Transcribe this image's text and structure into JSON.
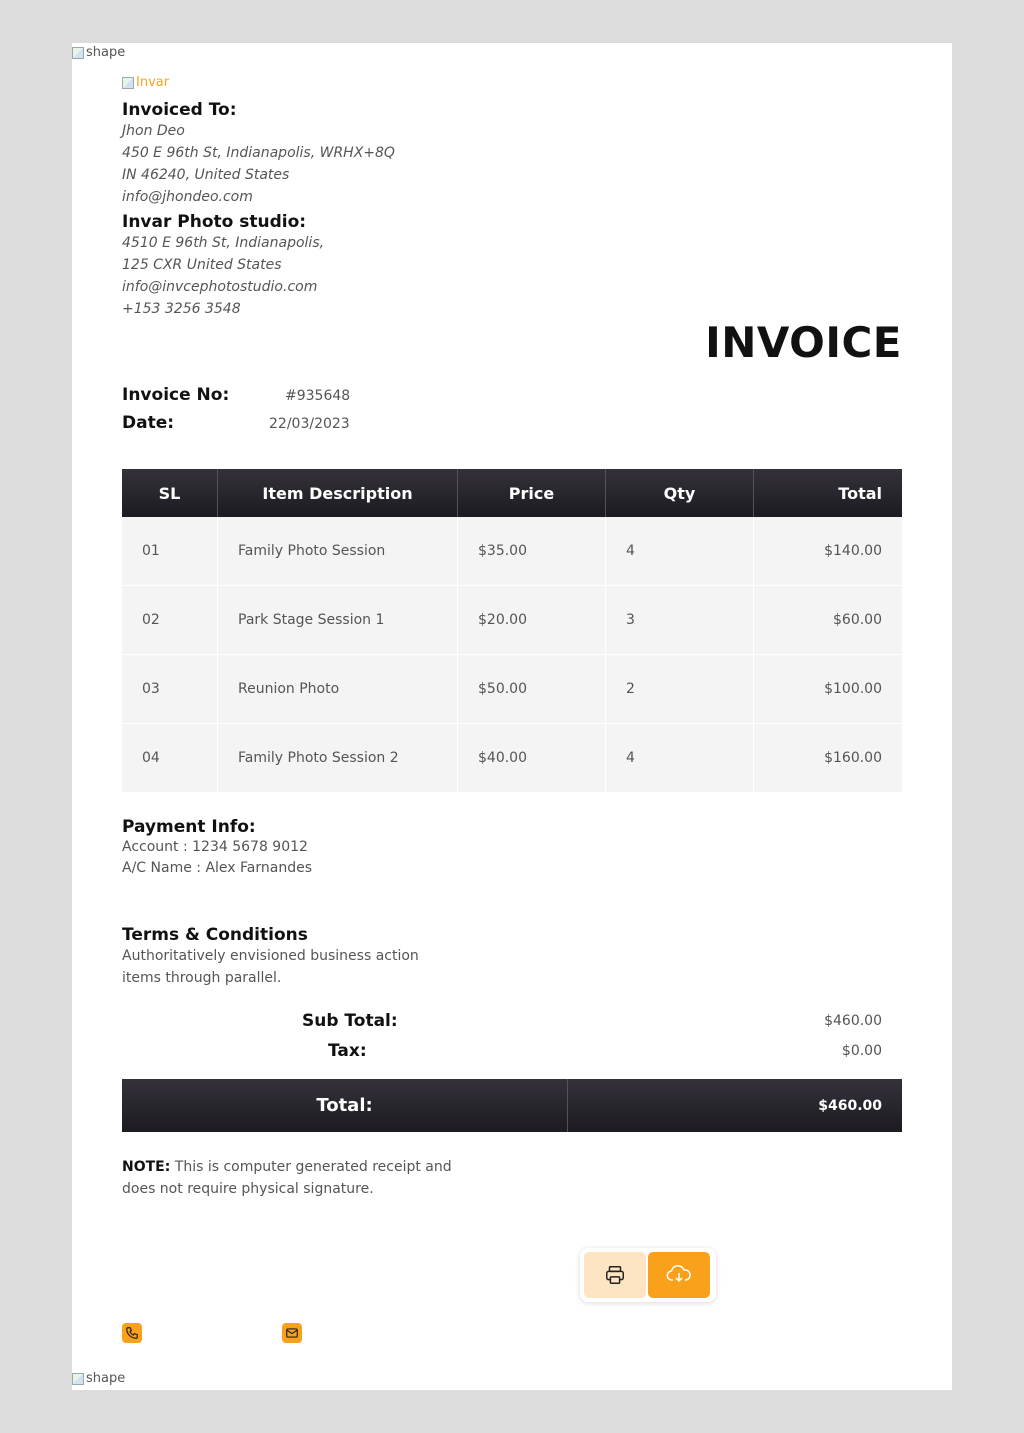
{
  "top_shape_alt": "shape",
  "bottom_shape_alt": "shape",
  "logo_alt": "Invar",
  "invoiced_to": {
    "label": "Invoiced To:",
    "name": "Jhon Deo",
    "address1": "450 E 96th St, Indianapolis, WRHX+8Q",
    "address2": "IN 46240, United States",
    "email": "info@jhondeo.com"
  },
  "studio": {
    "label": "Invar Photo studio:",
    "address1": "4510 E 96th St, Indianapolis,",
    "address2": "125 CXR United States",
    "email": "info@invcephotostudio.com",
    "phone": "+153 3256 3548"
  },
  "title": "INVOICE",
  "meta": {
    "invoice_no_label": "Invoice No:",
    "invoice_no": "#935648",
    "date_label": "Date:",
    "date": "22/03/2023"
  },
  "table": {
    "headers": [
      "SL",
      "Item Description",
      "Price",
      "Qty",
      "Total"
    ],
    "rows": [
      [
        "01",
        "Family Photo Session",
        "$35.00",
        "4",
        "$140.00"
      ],
      [
        "02",
        "Park Stage Session 1",
        "$20.00",
        "3",
        "$60.00"
      ],
      [
        "03",
        "Reunion Photo",
        "$50.00",
        "2",
        "$100.00"
      ],
      [
        "04",
        "Family Photo Session 2",
        "$40.00",
        "4",
        "$160.00"
      ]
    ]
  },
  "payment": {
    "label": "Payment Info:",
    "account": "Account : 1234 5678 9012",
    "ac_name": "A/C Name : Alex Farnandes"
  },
  "terms": {
    "label": "Terms & Conditions",
    "line1": "Authoritatively envisioned business action",
    "line2": "items through parallel."
  },
  "summary": {
    "subtotal_label": "Sub Total:",
    "subtotal": "$460.00",
    "tax_label": "Tax:",
    "tax": "$0.00",
    "total_label": "Total:",
    "total": "$460.00"
  },
  "note": {
    "label": "NOTE:",
    "text1": "This is computer generated receipt and",
    "text2": "does not require physical signature."
  },
  "colors": {
    "accent": "#f9a11b",
    "accent_light": "#fde4c2",
    "dark": "#1d1b21"
  },
  "icons": {
    "print": "printer-icon",
    "download": "cloud-download-icon",
    "phone": "phone-icon",
    "email": "envelope-icon"
  }
}
